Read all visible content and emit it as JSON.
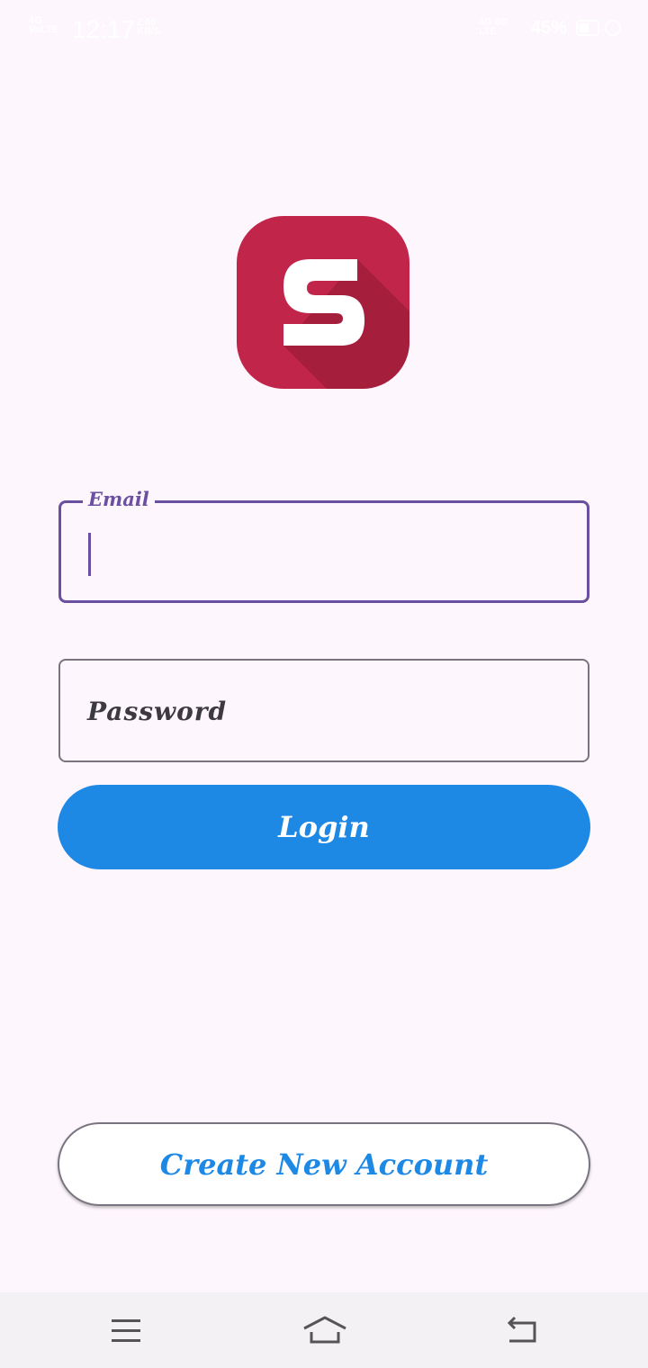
{
  "status_bar": {
    "network_small": "4G\nVoLTE",
    "time": "12:17",
    "speed": "2.00\nKB/S",
    "signal": "4G 4G\nLTE",
    "battery": "45%"
  },
  "logo": {
    "letter": "S",
    "color": "#c2254a"
  },
  "form": {
    "email_label": "Email",
    "email_value": "",
    "password_placeholder": "Password",
    "login_label": "Login"
  },
  "footer": {
    "create_account_label": "Create New Account"
  },
  "colors": {
    "accent": "#1e88e5",
    "focus": "#6b4fa0",
    "background": "#fdf6fc"
  },
  "nav": {
    "icons": [
      "menu-icon",
      "home-icon",
      "back-icon"
    ]
  }
}
